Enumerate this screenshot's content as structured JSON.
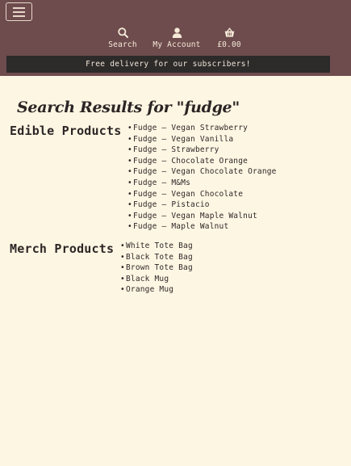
{
  "header": {
    "nav": [
      {
        "label": "Search",
        "icon": "search-icon"
      },
      {
        "label": "My Account",
        "icon": "user-icon"
      },
      {
        "label": "£0.00",
        "icon": "basket-icon"
      }
    ],
    "banner": "Free delivery for our subscribers!"
  },
  "main": {
    "title": "Search Results for \"fudge\"",
    "edible": {
      "heading": "Edible Products",
      "items": [
        "Fudge – Vegan Strawberry",
        "Fudge – Vegan Vanilla",
        "Fudge – Strawberry",
        "Fudge – Chocolate Orange",
        "Fudge – Vegan Chocolate Orange",
        "Fudge – M&Ms",
        "Fudge – Vegan Chocolate",
        "Fudge – Pistacio",
        "Fudge – Vegan Maple Walnut",
        "Fudge – Maple Walnut"
      ]
    },
    "merch": {
      "heading": "Merch Products",
      "items": [
        "White Tote Bag",
        "Black Tote Bag",
        "Brown Tote Bag",
        "Black Mug",
        "Orange Mug"
      ]
    }
  },
  "colors": {
    "header": "#6e4c4e",
    "banner": "#2d2a2a",
    "page": "#fdf6e3"
  }
}
